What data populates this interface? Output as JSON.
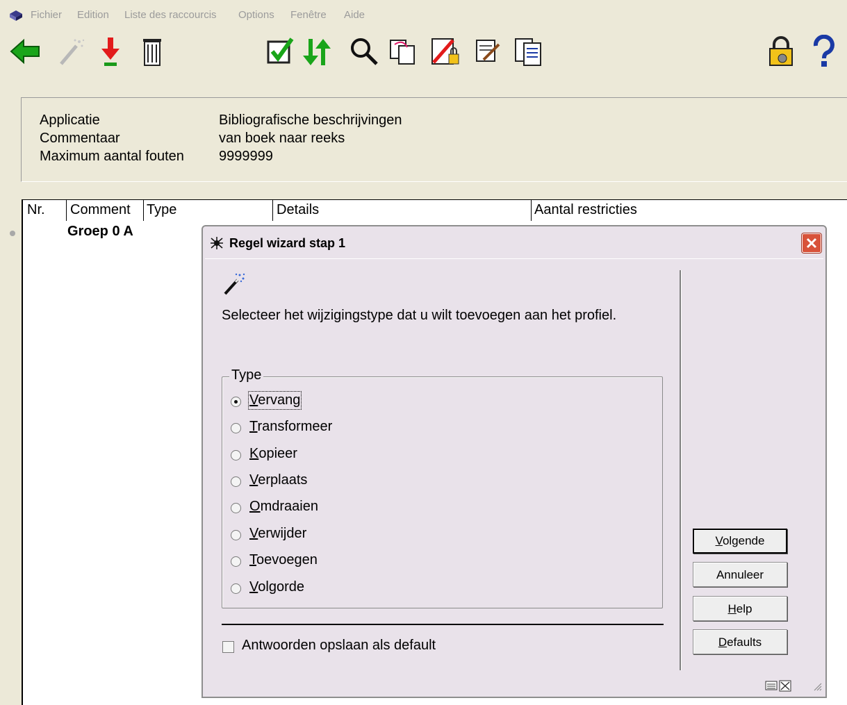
{
  "menu": {
    "items": [
      "Fichier",
      "Edition",
      "Liste des raccourcis",
      "Options",
      "Fenêtre",
      "Aide"
    ]
  },
  "toolbar": {
    "icons": [
      "back-arrow-icon",
      "wand-icon",
      "download-arrow-icon",
      "trash-icon",
      "checkbox-icon",
      "sort-arrows-icon",
      "search-icon",
      "copy-page-icon",
      "no-edit-lock-icon",
      "edit-document-icon",
      "clipboard-list-icon",
      "lock-settings-icon",
      "help-icon"
    ]
  },
  "info": {
    "applicatie_label": "Applicatie",
    "applicatie_value": "Bibliografische beschrijvingen",
    "commentaar_label": "Commentaar",
    "commentaar_value": "van boek naar reeks",
    "max_fouten_label": "Maximum aantal fouten",
    "max_fouten_value": "9999999"
  },
  "table": {
    "columns": [
      "Nr.",
      "Comment",
      "Type",
      "Details",
      "Aantal restricties"
    ],
    "group_label": "Groep 0 A"
  },
  "dialog": {
    "title": "Regel wizard stap 1",
    "instruction": "Selecteer het wijzigingstype dat u wilt toevoegen aan het profiel.",
    "group_title": "Type",
    "options": [
      {
        "accel": "V",
        "rest": "ervang",
        "checked": true
      },
      {
        "accel": "T",
        "rest": "ransformeer",
        "checked": false
      },
      {
        "accel": "K",
        "rest": "opieer",
        "checked": false
      },
      {
        "accel": "V",
        "rest": "erplaats",
        "checked": false
      },
      {
        "accel": "O",
        "rest": "mdraaien",
        "checked": false
      },
      {
        "accel": "V",
        "rest": "erwijder",
        "checked": false
      },
      {
        "accel": "T",
        "rest": "oevoegen",
        "checked": false
      },
      {
        "accel": "V",
        "rest": "olgorde",
        "checked": false
      }
    ],
    "save_defaults_label": "Antwoorden opslaan als default",
    "buttons": {
      "next_accel": "V",
      "next_rest": "olgende",
      "cancel": "Annuleer",
      "help_accel": "H",
      "help_rest": "elp",
      "defaults_accel": "D",
      "defaults_rest": "efaults"
    }
  },
  "colors": {
    "dialog_bg": "#e9e2ea",
    "app_bg": "#ece9d8",
    "close_button": "#d8523a"
  }
}
